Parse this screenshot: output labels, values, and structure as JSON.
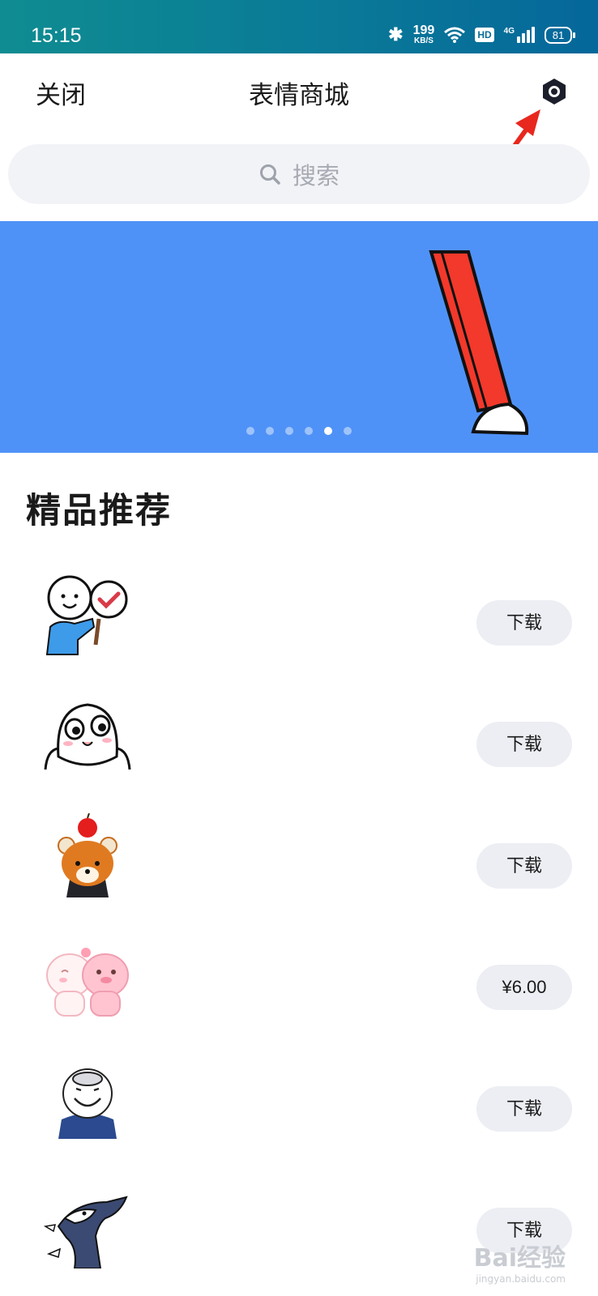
{
  "status_bar": {
    "time": "15:15",
    "net_speed": "199",
    "net_unit": "KB/S",
    "hd": "HD",
    "signal": "4G",
    "battery": "81"
  },
  "header": {
    "close": "关闭",
    "title": "表情商城"
  },
  "search": {
    "placeholder": "搜索"
  },
  "banner": {
    "dot_count": 6,
    "active_index": 4
  },
  "section": {
    "title": "精品推荐"
  },
  "stickers": [
    {
      "action": "下载",
      "icon": "thumbs-check-sign-sticker"
    },
    {
      "action": "下载",
      "icon": "white-ghost-sticker"
    },
    {
      "action": "下载",
      "icon": "red-panda-apple-sticker"
    },
    {
      "action": "¥6.00",
      "icon": "pink-pigs-sticker"
    },
    {
      "action": "下载",
      "icon": "laughing-face-sticker"
    },
    {
      "action": "下载",
      "icon": "dragon-sticker"
    }
  ],
  "watermark": {
    "text": "Bai经验",
    "sub": "jingyan.baidu.com"
  },
  "colors": {
    "banner": "#4f92f7",
    "status_bar": "#0a7a98",
    "arrow": "#e8281e"
  }
}
